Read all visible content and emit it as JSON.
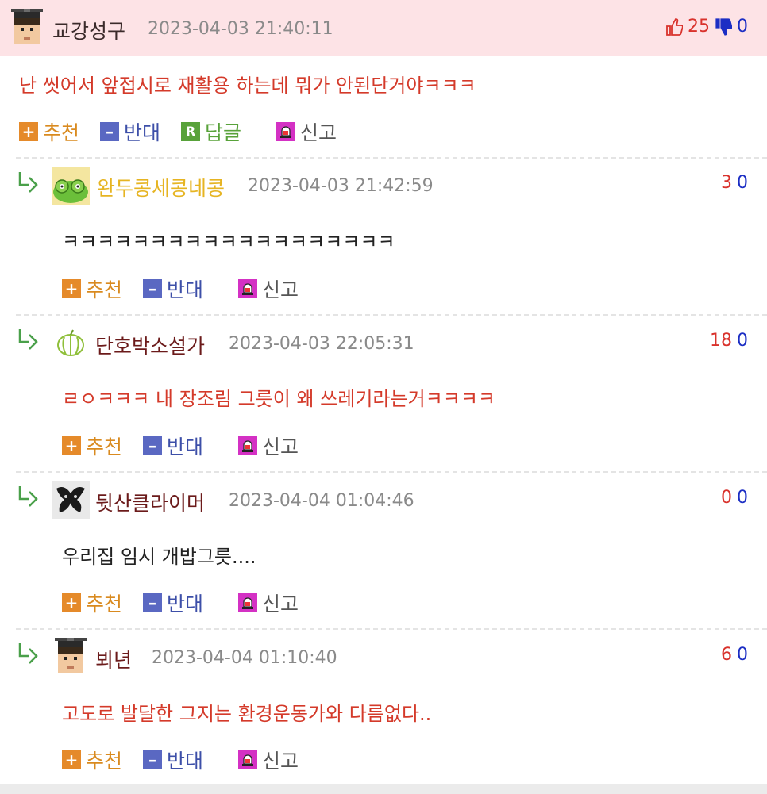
{
  "comments": [
    {
      "nickname": "교강성구",
      "timestamp": "2023-04-03 21:40:11",
      "up": "25",
      "down": "0",
      "text": "난 씻어서 앞접시로 재활용 하는데 뭐가 안된단거야ㅋㅋㅋ",
      "actions": {
        "recommend": "추천",
        "oppose": "반대",
        "reply": "답글",
        "report": "신고"
      }
    },
    {
      "nickname": "완두콩세콩네콩",
      "timestamp": "2023-04-03 21:42:59",
      "up": "3",
      "down": "0",
      "text": "ㅋㅋㅋㅋㅋㅋㅋㅋㅋㅋㅋㅋㅋㅋㅋㅋㅋㅋㅋ",
      "actions": {
        "recommend": "추천",
        "oppose": "반대",
        "report": "신고"
      }
    },
    {
      "nickname": "단호박소설가",
      "timestamp": "2023-04-03 22:05:31",
      "up": "18",
      "down": "0",
      "text": "ㄹㅇㅋㅋㅋ 내 장조림 그릇이 왜 쓰레기라는거ㅋㅋㅋㅋ",
      "actions": {
        "recommend": "추천",
        "oppose": "반대",
        "report": "신고"
      }
    },
    {
      "nickname": "뒷산클라이머",
      "timestamp": "2023-04-04 01:04:46",
      "up": "0",
      "down": "0",
      "text": "우리집 임시 개밥그릇....",
      "actions": {
        "recommend": "추천",
        "oppose": "반대",
        "report": "신고"
      }
    },
    {
      "nickname": "뵈년",
      "timestamp": "2023-04-04 01:10:40",
      "up": "6",
      "down": "0",
      "text": "고도로 발달한 그지는 환경운동가와 다름없다..",
      "actions": {
        "recommend": "추천",
        "oppose": "반대",
        "report": "신고"
      }
    }
  ],
  "icons": {
    "recommend": "plus-icon",
    "oppose": "minus-icon",
    "reply": "reply-r-icon",
    "report": "siren-icon",
    "thumb_up": "thumbs-up-icon",
    "thumb_down": "thumbs-down-icon",
    "reply_arrow": "reply-arrow-icon"
  },
  "colors": {
    "top_bg": "#fde3e6",
    "recommend": "#d98a1f",
    "oppose": "#3d4fa8",
    "reply": "#58a23a",
    "report_icon": "#d431c4",
    "vote_up": "#d9322c",
    "vote_down": "#1c2ec4"
  }
}
